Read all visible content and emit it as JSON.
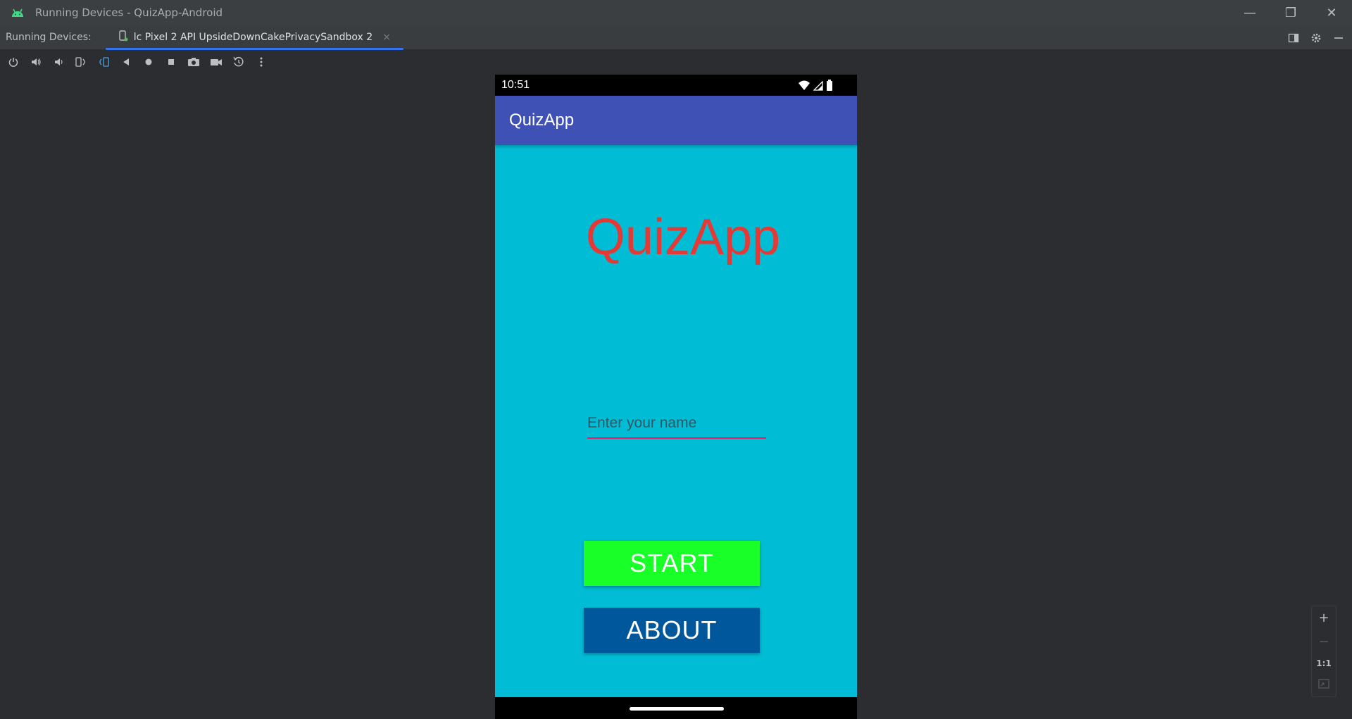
{
  "window": {
    "title": "Running Devices - QuizApp-Android",
    "controls": {
      "minimize": "—",
      "restore": "❐",
      "close": "✕"
    }
  },
  "tool_window": {
    "label": "Running Devices:",
    "device_tab": {
      "label": "lc Pixel 2 API UpsideDownCakePrivacySandbox 2",
      "close": "×"
    }
  },
  "toolbar": {
    "buttons": [
      "power-icon",
      "volume-up-icon",
      "volume-down-icon",
      "rotate-left-icon",
      "rotate-right-icon",
      "back-icon",
      "home-icon",
      "overview-icon",
      "screenshot-icon",
      "screen-record-icon",
      "snapshot-icon",
      "more-icon"
    ]
  },
  "device": {
    "status_time": "10:51",
    "app_bar_title": "QuizApp",
    "heading": "QuizApp",
    "name_placeholder": "Enter your name",
    "start_label": "START",
    "about_label": "ABOUT",
    "colors": {
      "background": "#00bcd4",
      "app_bar": "#3f51b5",
      "heading": "#e53935",
      "start": "#19ff28",
      "about": "#01579b",
      "underline": "#e91e63"
    }
  },
  "zoom": {
    "in": "+",
    "out": "−",
    "actual": "1:1"
  }
}
